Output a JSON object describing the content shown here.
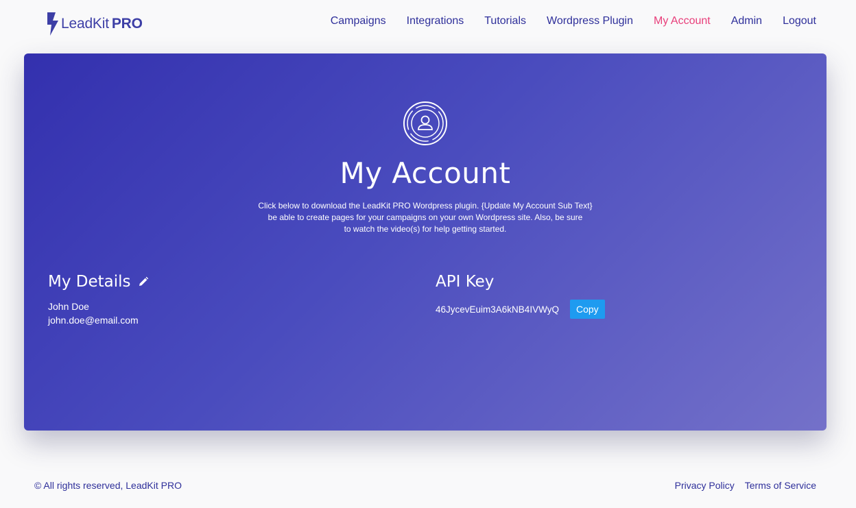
{
  "brand": {
    "name": "LeadKit",
    "suffix": "PRO",
    "color": "#3d3fa6"
  },
  "nav": {
    "items": [
      {
        "label": "Campaigns"
      },
      {
        "label": "Integrations"
      },
      {
        "label": "Tutorials"
      },
      {
        "label": "Wordpress Plugin"
      },
      {
        "label": "My Account",
        "active": true
      },
      {
        "label": "Admin"
      },
      {
        "label": "Logout"
      }
    ],
    "active_color": "#e83e7a"
  },
  "hero": {
    "icon": "user-circle-icon",
    "title": "My Account",
    "subtext_lines": [
      "Click below to download the LeadKit PRO Wordpress plugin. {Update My Account Sub Text}",
      "be able to create pages for your campaigns on your own Wordpress site. Also, be sure",
      "to watch the video(s) for help getting started."
    ]
  },
  "details": {
    "title": "My Details",
    "edit_icon": "pencil-icon",
    "name": "John Doe",
    "email": "john.doe@email.com"
  },
  "api": {
    "title": "API Key",
    "key": "46JycevEuim3A6kNB4IVWyQ",
    "copy_label": "Copy",
    "copy_color": "#1e9bf0"
  },
  "footer": {
    "copyright": "© All rights reserved, LeadKit PRO",
    "links": [
      {
        "label": "Privacy Policy"
      },
      {
        "label": "Terms of Service"
      }
    ]
  }
}
